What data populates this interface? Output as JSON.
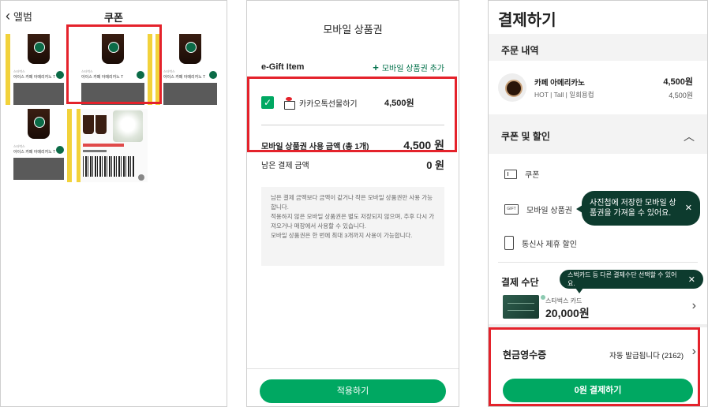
{
  "album": {
    "back_label": "앨범",
    "title": "쿠폰",
    "coupons": [
      {
        "brand": "스타벅스",
        "name": "아이스 카페 아메리카노 T"
      },
      {
        "brand": "스타벅스",
        "name": "아이스 카페 아메리카노 T"
      },
      {
        "brand": "스타벅스",
        "name": "아이스 카페 아메리카노 T"
      },
      {
        "brand": "스타벅스",
        "name": "아이스 카페 아메리카노 T"
      }
    ]
  },
  "gift": {
    "title": "모바일 상품권",
    "section_label": "e-Gift Item",
    "add_label": "모바일 상품권 추가",
    "item_name": "카카오톡선물하기",
    "item_price": "4,500원",
    "used_label": "모바일 상품권 사용 금액 (총 1개)",
    "used_value": "4,500 원",
    "remaining_label": "남은 결제 금액",
    "remaining_value": "0 원",
    "notes": [
      "남은 결제 금액보다 금액이 같거나 작은 모바일 상품권만 사용 가능합니다.",
      "적용하지 않은 모바일 상품권은 별도 저장되지 않으며, 추후 다시 가져오거나 매장에서 사용할 수 있습니다.",
      "모바일 상품권은 한 번에 최대 3개까지 사용이 가능합니다."
    ],
    "apply_label": "적용하기"
  },
  "payment": {
    "title": "결제하기",
    "order_header": "주문 내역",
    "item_name": "카페 아메리카노",
    "item_options": "HOT | Tall | 일회용컵",
    "item_price": "4,500원",
    "item_price_sub": "4,500원",
    "coupon_header": "쿠폰 및 할인",
    "options": {
      "coupon": "쿠폰",
      "mobile_gift": "모바일 상품권",
      "mobile_gift_icon_text": "GIFT",
      "telecom": "통신사 제휴 할인"
    },
    "tooltip_gift": "사진첩에 저장한 모바일 상품권을 가져올 수 있어요.",
    "method_header": "결제 수단",
    "tooltip_method": "스벅카드 등 다른 결제수단 선택할 수 있어요.",
    "card_name": "스타벅스 카드",
    "card_balance": "20,000원",
    "receipt_label": "현금영수증",
    "receipt_value": "자동 발급됩니다 (2162)",
    "pay_label": "0원 결제하기"
  },
  "colors": {
    "accent_green": "#00a862",
    "highlight_red": "#e4222b",
    "tooltip_bg": "#0d3b2e"
  }
}
